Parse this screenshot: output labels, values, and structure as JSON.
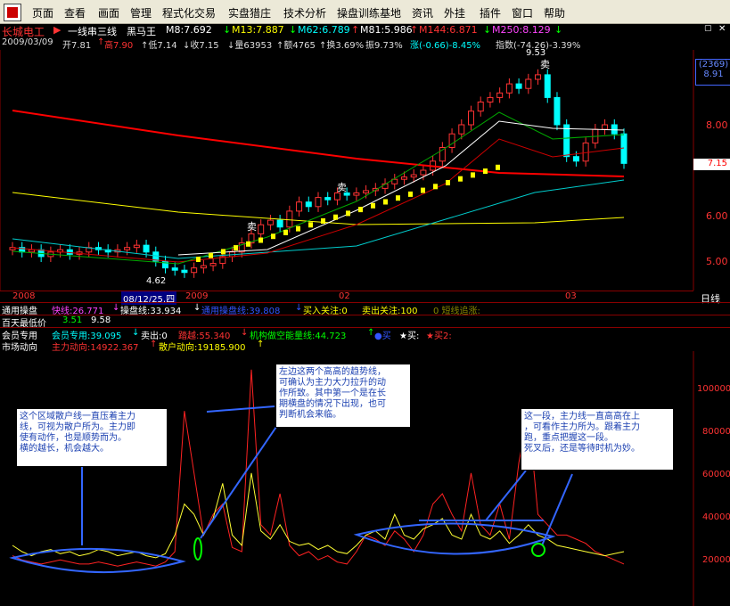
{
  "menu": {
    "items": [
      "页面",
      "查看",
      "画面",
      "管理",
      "程式化交易",
      "实盘猎庄",
      "技术分析",
      "操盘训练基地",
      "资讯",
      "外挂",
      "插件",
      "窗口",
      "帮助"
    ]
  },
  "stock": {
    "name": "长城电工",
    "indicator_name": "一线串三线",
    "formula_name": "黑马王",
    "ma": [
      {
        "label": "M8:7.692",
        "arrow": "↓",
        "color": "#ffffff"
      },
      {
        "label": "M13:7.887",
        "arrow": "↓",
        "color": "#ffff00"
      },
      {
        "label": "M62:6.789",
        "arrow": "↑",
        "color": "#00ffff"
      },
      {
        "label": "M81:5.986",
        "arrow": "↑",
        "color": "#ffffff"
      },
      {
        "label": "M144:6.871",
        "arrow": "↓",
        "color": "#ff3333"
      },
      {
        "label": "M250:8.129",
        "arrow": "↓",
        "color": "#ff44ff"
      }
    ],
    "quote_line": {
      "date": "2009/03/09",
      "open": "开7.81",
      "open_arrow": "↑",
      "high": "高7.90",
      "low": "↑低7.14",
      "close": "↓收7.15",
      "vol": "↓量63953",
      "amount": "↑额4765",
      "turnover": "↑换3.69%",
      "amplitude": "振9.73%",
      "change": "涨(-0.66)-8.45%",
      "index": "指数(-74.26)-3.39%"
    },
    "price_box": "(2369)",
    "price_box_value": "8.91",
    "current_price_tag": "7.15",
    "y_labels": [
      "8.00",
      "7.00",
      "6.00",
      "5.00"
    ],
    "high_label": "9.53",
    "low_label": "4.62",
    "sell_label": "卖",
    "x_labels": [
      "2008",
      "08/12/25,四",
      "2009",
      "02",
      "03"
    ],
    "day_line": "日线"
  },
  "indicator_rows": {
    "row1": {
      "title": "通用操盘",
      "fast": "快线:26.771",
      "fast_arrow": "↓",
      "operate": "操盘线:33.934",
      "operate_arrow": "↓",
      "general": "通用操盘线:39.808",
      "general_arrow": "↓",
      "buy_watch": "买入关注:0",
      "sell_watch": "卖出关注:100",
      "short_track": "0  短线追涨:"
    },
    "row2": {
      "title": "百天最低价",
      "v1": "3.51",
      "v2": "9.58"
    },
    "row3": {
      "title": "会员专用",
      "member": "会员专用:39.095",
      "member_arrow": "↓",
      "sell": "卖出:0",
      "jump": "踏越:55.340",
      "jump_arrow": "↓",
      "institution": "机构做空能量线:44.723",
      "inst_arrow": "↑",
      "buy": "●买",
      "buy2": "★买:",
      "buy3": "★买2:"
    },
    "row4": {
      "title": "市场动向",
      "main": "主力动向:14922.367",
      "main_arrow": "↑",
      "retail": "散户动向:19185.900",
      "retail_arrow": "↑"
    }
  },
  "lower": {
    "y_labels": [
      "100000",
      "80000",
      "60000",
      "40000",
      "20000"
    ],
    "notes": [
      "这个区域散户线一直压着主力\n线，可视为散户所为。主力即\n使有动作，也是顺势而为。\n横的越长，机会越大。",
      "左边这两个高高的趋势线，\n可确认为主力大力拉升的动\n作所致。其中第一个是在长\n期横盘的情况下出现，也可\n判断机会来临。",
      "这一段，主力线一直高高在上\n，可看作主力所为。跟着主力\n跑，重点把握这一段。\n死叉后，还是等待时机为妙。"
    ]
  },
  "colors": {
    "up": "#ff3333",
    "down": "#00ffff",
    "yellow": "#ffff00",
    "blue_note": "#3366ff",
    "bg": "#000000"
  },
  "chart_data": {
    "type": "line",
    "series": [
      {
        "name": "主力动向",
        "values": [
          20000,
          18000,
          17000,
          16000,
          17000,
          18000,
          17000,
          16000,
          16000,
          17000,
          16000,
          15000,
          16000,
          17000,
          16000,
          15000,
          17000,
          22000,
          90000,
          60000,
          30000,
          40000,
          45000,
          24000,
          22000,
          110000,
          35000,
          30000,
          50000,
          25000,
          20000,
          22000,
          18000,
          20000,
          17000,
          16000,
          22000,
          30000,
          28000,
          25000,
          32000,
          28000,
          22000,
          30000,
          45000,
          50000,
          40000,
          32000,
          60000,
          35000,
          30000,
          45000,
          28000,
          65000,
          90000,
          40000,
          35000,
          30000,
          30000,
          28000,
          26000,
          22000,
          20000,
          18000,
          16000
        ]
      },
      {
        "name": "散户动向",
        "values": [
          25000,
          22000,
          20000,
          22000,
          23000,
          21000,
          22000,
          20000,
          21000,
          23000,
          22000,
          20000,
          21000,
          22000,
          20000,
          19000,
          21000,
          30000,
          45000,
          40000,
          30000,
          38000,
          55000,
          30000,
          25000,
          60000,
          32000,
          28000,
          35000,
          27000,
          25000,
          26000,
          23000,
          25000,
          22000,
          21000,
          25000,
          30000,
          32000,
          28000,
          40000,
          30000,
          28000,
          33000,
          35000,
          38000,
          30000,
          28000,
          40000,
          30000,
          28000,
          32000,
          26000,
          30000,
          35000,
          30000,
          28000,
          25000,
          24000,
          23000,
          22000,
          21000,
          20000,
          21000,
          22000
        ]
      }
    ],
    "ylim": [
      0,
      120000
    ]
  }
}
